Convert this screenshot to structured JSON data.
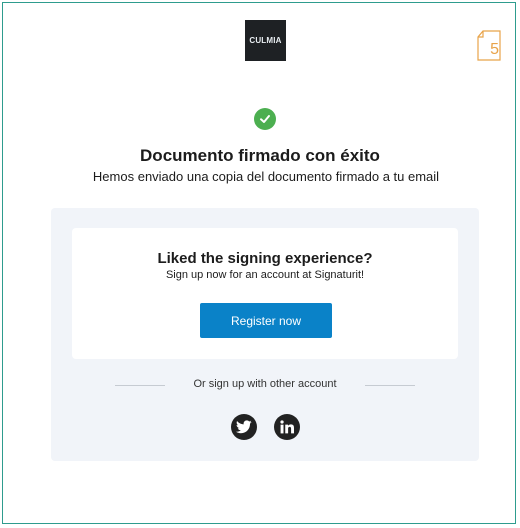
{
  "header": {
    "logo_text": "CULMIA",
    "page_number": "5"
  },
  "status": {
    "title": "Documento firmado con éxito",
    "subtitle": "Hemos enviado una copia del documento firmado a tu email"
  },
  "promo": {
    "title": "Liked the signing experience?",
    "subtitle": "Sign up now for an account at Signaturit!",
    "register_label": "Register now",
    "alt_signup_text": "Or sign up with other account"
  },
  "social": {
    "providers": [
      {
        "name": "twitter-icon"
      },
      {
        "name": "linkedin-icon"
      }
    ]
  },
  "colors": {
    "accent_blue": "#0a82c8",
    "success_green": "#4caf50",
    "badge_orange": "#e8a349",
    "frame_teal": "#2e9c8e",
    "panel_bg": "#f1f4f9"
  }
}
